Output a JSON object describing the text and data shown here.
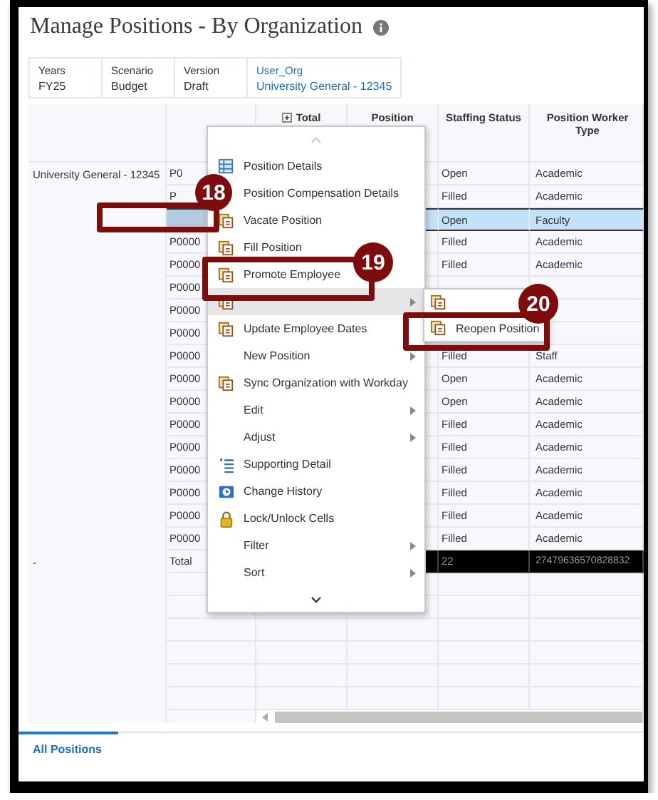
{
  "title": "Manage Positions - By Organization",
  "pov": [
    {
      "label": "Years",
      "value": "FY25",
      "kind": "plain"
    },
    {
      "label": "Scenario",
      "value": "Budget",
      "kind": "plain"
    },
    {
      "label": "Version",
      "value": "Draft",
      "kind": "plain"
    },
    {
      "label": "User_Org",
      "value": "University General - 12345",
      "kind": "link"
    }
  ],
  "columns": [
    "Total",
    "Position",
    "Staffing Status",
    "Position Worker Type"
  ],
  "rows": [
    {
      "org": "University General - 12345",
      "position": "P0",
      "staffing": "Open",
      "worker_type": "Academic",
      "selected": false
    },
    {
      "position": "P",
      "staffing": "Filled",
      "worker_type": "Academic",
      "selected": false
    },
    {
      "staffing": "Open",
      "worker_type": "Faculty",
      "selected": true
    },
    {
      "position": "P0000",
      "staffing": "Filled",
      "worker_type": "Academic",
      "selected": false
    },
    {
      "position": "P0000",
      "staffing": "Filled",
      "worker_type": "Academic",
      "selected": false
    },
    {
      "position": "P0000",
      "selected": false
    },
    {
      "position": "P0000",
      "selected": false
    },
    {
      "position": "P0000",
      "selected": false
    },
    {
      "position": "P0000",
      "staffing": "Filled",
      "worker_type": "Staff",
      "selected": false
    },
    {
      "position": "P0000",
      "staffing": "Open",
      "worker_type": "Academic",
      "selected": false
    },
    {
      "position": "P0000",
      "staffing": "Open",
      "worker_type": "Academic",
      "selected": false
    },
    {
      "position": "P0000",
      "staffing": "Filled",
      "worker_type": "Academic",
      "selected": false
    },
    {
      "position": "P0000",
      "staffing": "Filled",
      "worker_type": "Academic",
      "selected": false
    },
    {
      "position": "P0000",
      "staffing": "Filled",
      "worker_type": "Academic",
      "selected": false
    },
    {
      "position": "P0000",
      "staffing": "Filled",
      "worker_type": "Academic",
      "selected": false
    },
    {
      "position": "P0000",
      "staffing": "Filled",
      "worker_type": "Academic",
      "selected": false
    },
    {
      "position": "P0000",
      "staffing": "Filled",
      "worker_type": "Academic",
      "selected": false
    }
  ],
  "total": {
    "org": "-",
    "position": "Total",
    "staffing": "22",
    "worker_type": "27479636570828832"
  },
  "menu": [
    {
      "kind": "grid",
      "label": "Position Details",
      "submenu": false,
      "selected": false
    },
    {
      "kind": "text",
      "label": "Position Compensation Details",
      "submenu": false,
      "selected": false
    },
    {
      "kind": "document",
      "label": "Vacate Position",
      "submenu": false,
      "selected": false
    },
    {
      "kind": "document",
      "label": "Fill Position",
      "submenu": false,
      "selected": false
    },
    {
      "kind": "document",
      "label": "Promote Employee",
      "submenu": false,
      "selected": false
    },
    {
      "kind": "covered",
      "submenu": true,
      "selected": true
    },
    {
      "kind": "document",
      "label": "Update Employee Dates",
      "submenu": false,
      "selected": false
    },
    {
      "kind": "text",
      "label": "New Position",
      "submenu": true,
      "selected": false
    },
    {
      "kind": "document",
      "label": "Sync Organization with Workday",
      "submenu": false,
      "selected": false
    },
    {
      "kind": "text",
      "label": "Edit",
      "submenu": true,
      "selected": false
    },
    {
      "kind": "text",
      "label": "Adjust",
      "submenu": true,
      "selected": false
    },
    {
      "kind": "list",
      "label": "Supporting Detail",
      "submenu": false,
      "selected": false
    },
    {
      "kind": "history",
      "label": "Change History",
      "submenu": false,
      "selected": false
    },
    {
      "kind": "lock",
      "label": "Lock/Unlock Cells",
      "submenu": false,
      "selected": false
    },
    {
      "kind": "text",
      "label": "Filter",
      "submenu": true,
      "selected": false
    },
    {
      "kind": "text",
      "label": "Sort",
      "submenu": true,
      "selected": false
    }
  ],
  "submenu": [
    {
      "kind": "covered"
    },
    {
      "kind": "document",
      "label": "Reopen Position"
    }
  ],
  "callouts": [
    {
      "number": "18"
    },
    {
      "number": "19"
    },
    {
      "number": "20"
    }
  ],
  "tabs": [
    {
      "label": "All Positions",
      "selected": true
    }
  ]
}
